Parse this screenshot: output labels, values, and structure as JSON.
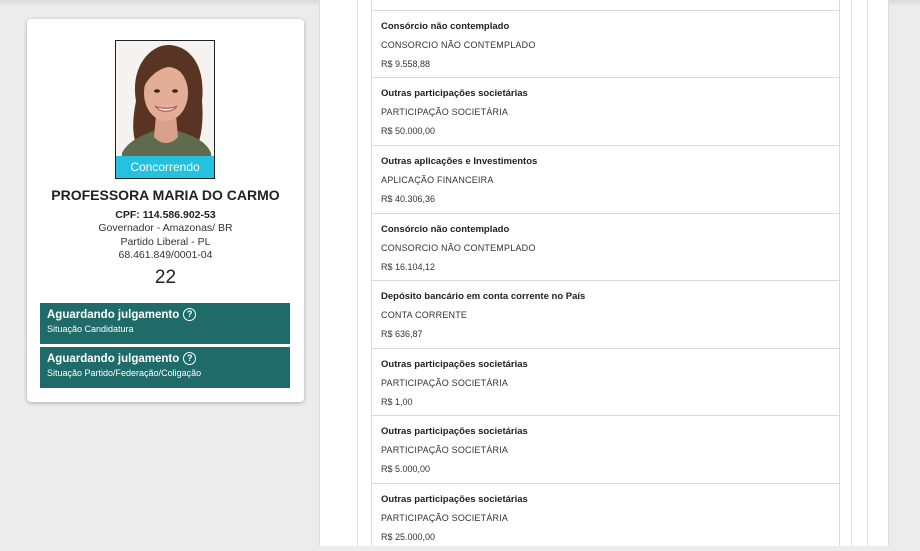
{
  "candidate": {
    "status_strip": "Concorrendo",
    "name": "PROFESSORA MARIA DO CARMO",
    "cpf": "CPF: 114.586.902-53",
    "cargo": "Governador - Amazonas/ BR",
    "partido": "Partido Liberal - PL",
    "cnpj": "68.461.849/0001-04",
    "numero": "22"
  },
  "status_boxes": [
    {
      "title": "Aguardando julgamento",
      "subtitle": "Situação Candidatura",
      "icon": "question-circle-icon"
    },
    {
      "title": "Aguardando julgamento",
      "subtitle": "Situação Partido/Federação/Coligação",
      "icon": "question-circle-icon"
    }
  ],
  "assets": [
    {
      "title": "Consórcio não contemplado",
      "type": "CONSORCIO NÃO CONTEMPLADO",
      "value": "R$ 9.558,88"
    },
    {
      "title": "Outras participações societárias",
      "type": "PARTICIPAÇÃO SOCIETÁRIA",
      "value": "R$ 50.000,00"
    },
    {
      "title": "Outras aplicações e Investimentos",
      "type": "APLICAÇÃO FINANCEIRA",
      "value": "R$ 40.306,36"
    },
    {
      "title": "Consórcio não contemplado",
      "type": "CONSORCIO NÃO CONTEMPLADO",
      "value": "R$ 16.104,12"
    },
    {
      "title": "Depósito bancário em conta corrente no País",
      "type": "CONTA CORRENTE",
      "value": "R$ 636,87"
    },
    {
      "title": "Outras participações societárias",
      "type": "PARTICIPAÇÃO SOCIETÁRIA",
      "value": "R$ 1,00"
    },
    {
      "title": "Outras participações societárias",
      "type": "PARTICIPAÇÃO SOCIETÁRIA",
      "value": "R$ 5.000,00"
    },
    {
      "title": "Outras participações societárias",
      "type": "PARTICIPAÇÃO SOCIETÁRIA",
      "value": "R$ 25.000,00"
    }
  ],
  "colors": {
    "status_strip": "#25c2df",
    "status_box": "#1e6b69"
  }
}
